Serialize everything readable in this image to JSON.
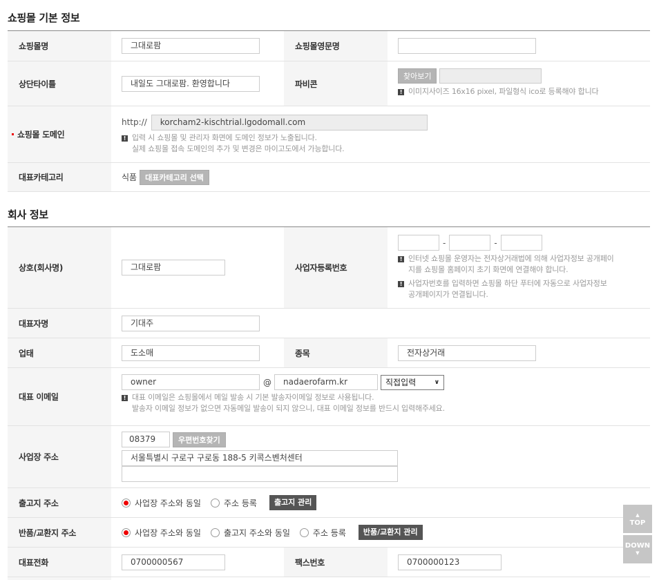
{
  "shop_basic": {
    "title": "쇼핑몰 기본 정보",
    "mall_name_label": "쇼핑몰명",
    "mall_name_value": "그대로팜",
    "mall_eng_name_label": "쇼핑몰영문명",
    "mall_eng_name_value": "",
    "top_title_label": "상단타이틀",
    "top_title_value": "내일도 그대로팜. 환영합니다",
    "favicon_label": "파비콘",
    "favicon_browse_button": "찾아보기",
    "favicon_file_value": "",
    "favicon_notice": "이미지사이즈 16x16 pixel, 파일형식 ico로 등록해야 합니다",
    "domain_label": "쇼핑몰 도메인",
    "domain_prefix": "http://",
    "domain_value": "korcham2-kischtrial.lgodomall.com",
    "domain_notice_line1": "입력 시 쇼핑몰 및 관리자 화면에 도메인 정보가 노출됩니다.",
    "domain_notice_line2": "실제 쇼핑몰 접속 도메인의 추가 및 변경은 마이고도에서 가능합니다.",
    "category_label": "대표카테고리",
    "category_value": "식품",
    "category_select_button": "대표카테고리 선택"
  },
  "company": {
    "title": "회사 정보",
    "company_name_label": "상호(회사명)",
    "company_name_value": "그대로팜",
    "biz_reg_label": "사업자등록번호",
    "biz_reg_parts": [
      "",
      "",
      ""
    ],
    "biz_reg_separator": "-",
    "biz_reg_notice1_line1": "인터넷 쇼핑몰 운영자는 전자상거래법에 의해 사업자정보 공개페이",
    "biz_reg_notice1_line2": "지를 쇼핑몰 홈페이지 초기 화면에 연결해야 합니다.",
    "biz_reg_notice2_line1": "사업자번호를 입력하면 쇼핑몰 하단 푸터에 자동으로 사업자정보",
    "biz_reg_notice2_line2": "공개페이지가 연결됩니다.",
    "ceo_label": "대표자명",
    "ceo_value": "기대주",
    "biz_type_label": "업태",
    "biz_type_value": "도소매",
    "biz_item_label": "종목",
    "biz_item_value": "전자상거래",
    "email_label": "대표 이메일",
    "email_id": "owner",
    "email_at": "@",
    "email_domain": "nadaerofarm.kr",
    "email_domain_select": "직접입력",
    "email_notice_line1": "대표 이메일은 쇼핑몰에서 메일 발송 시 기본 발송자이메일 정보로 사용됩니다.",
    "email_notice_line2": "발송자 이메일 정보가 없으면 자동메일 발송이 되지 않으니, 대표 이메일 정보를 반드시 입력해주세요.",
    "address_label": "사업장 주소",
    "zipcode": "08379",
    "zipcode_button": "우편번호찾기",
    "address_line1": "서울특별시 구로구 구로동 188-5 키콕스벤처센터",
    "address_line2": "",
    "shipping_label": "출고지 주소",
    "shipping_options": [
      "사업장 주소와 동일",
      "주소 등록"
    ],
    "shipping_selected": 0,
    "shipping_manage_button": "출고지 관리",
    "return_label": "반품/교환지 주소",
    "return_options": [
      "사업장 주소와 동일",
      "출고지 주소와 동일",
      "주소 등록"
    ],
    "return_selected": 0,
    "return_manage_button": "반품/교환지 관리",
    "phone_label": "대표전화",
    "phone_value": "0700000567",
    "fax_label": "팩스번호",
    "fax_value": "0700000123"
  },
  "float_nav": {
    "top_label": "TOP",
    "down_label": "DOWN"
  }
}
